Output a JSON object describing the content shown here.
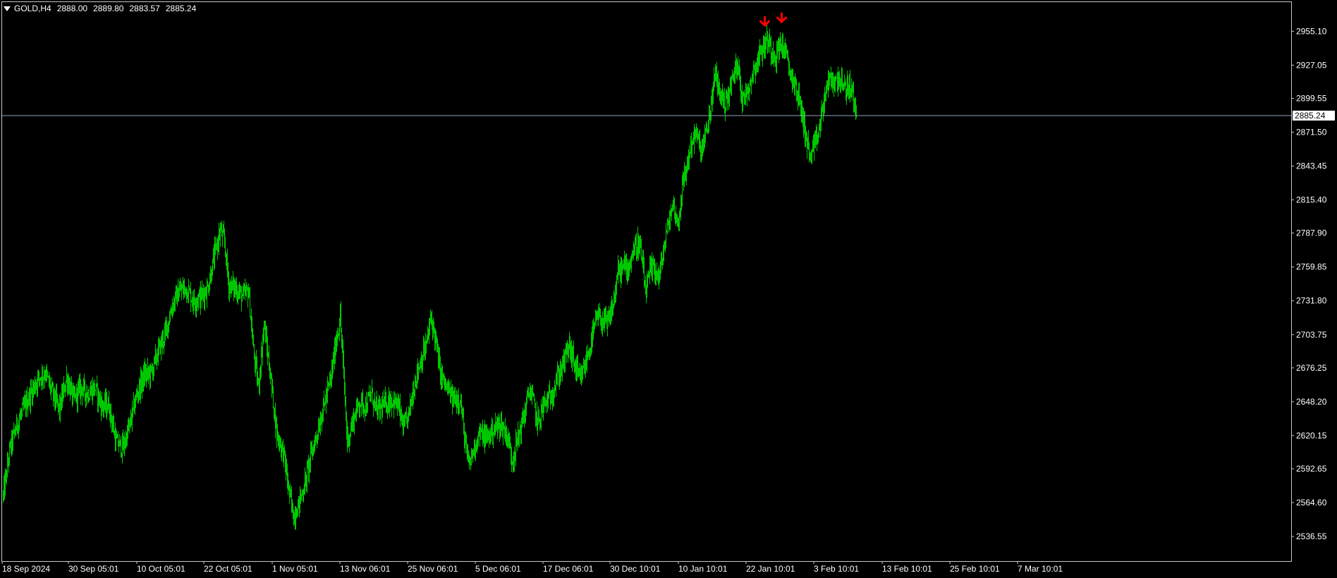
{
  "header": {
    "symbol": "GOLD,H4",
    "open": "2888.00",
    "high": "2889.80",
    "low": "2883.57",
    "close": "2885.24"
  },
  "colors": {
    "background": "#000000",
    "frame": "#c8c8c8",
    "text": "#ffffff",
    "bars": "#00c800",
    "price_line": "#8ea3b8",
    "arrow": "#ff0000"
  },
  "current_price_label": "2885.24",
  "chart_data": {
    "type": "bar",
    "style": "ohlc-bars",
    "symbol": "GOLD",
    "timeframe": "H4",
    "ylim": [
      2522,
      2974
    ],
    "y_ticks": [
      "2955.10",
      "2927.05",
      "2899.55",
      "2871.50",
      "2843.45",
      "2815.40",
      "2787.90",
      "2759.85",
      "2731.80",
      "2703.75",
      "2676.25",
      "2648.20",
      "2620.15",
      "2592.65",
      "2564.60",
      "2536.55"
    ],
    "x_ticks": [
      "18 Sep 2024",
      "30 Sep 05:01",
      "10 Oct 05:01",
      "22 Oct 05:01",
      "1 Nov 05:01",
      "13 Nov 06:01",
      "25 Nov 06:01",
      "5 Dec 06:01",
      "17 Dec 06:01",
      "30 Dec 10:01",
      "10 Jan 10:01",
      "22 Jan 10:01",
      "3 Feb 10:01",
      "13 Feb 10:01",
      "25 Feb 10:01",
      "7 Mar 10:01"
    ],
    "current_price": 2885.24,
    "close_path": [
      [
        0,
        2570
      ],
      [
        10,
        2610
      ],
      [
        20,
        2630
      ],
      [
        35,
        2650
      ],
      [
        50,
        2668
      ],
      [
        60,
        2672
      ],
      [
        70,
        2655
      ],
      [
        80,
        2642
      ],
      [
        90,
        2668
      ],
      [
        100,
        2650
      ],
      [
        110,
        2660
      ],
      [
        120,
        2655
      ],
      [
        130,
        2660
      ],
      [
        140,
        2645
      ],
      [
        150,
        2645
      ],
      [
        160,
        2615
      ],
      [
        170,
        2610
      ],
      [
        180,
        2630
      ],
      [
        190,
        2655
      ],
      [
        200,
        2670
      ],
      [
        210,
        2672
      ],
      [
        220,
        2690
      ],
      [
        230,
        2705
      ],
      [
        240,
        2728
      ],
      [
        250,
        2740
      ],
      [
        260,
        2742
      ],
      [
        270,
        2732
      ],
      [
        280,
        2735
      ],
      [
        290,
        2742
      ],
      [
        300,
        2770
      ],
      [
        308,
        2790
      ],
      [
        314,
        2780
      ],
      [
        320,
        2745
      ],
      [
        330,
        2742
      ],
      [
        340,
        2735
      ],
      [
        348,
        2740
      ],
      [
        355,
        2690
      ],
      [
        362,
        2660
      ],
      [
        370,
        2712
      ],
      [
        380,
        2665
      ],
      [
        388,
        2622
      ],
      [
        398,
        2605
      ],
      [
        405,
        2575
      ],
      [
        412,
        2553
      ],
      [
        420,
        2565
      ],
      [
        428,
        2580
      ],
      [
        435,
        2600
      ],
      [
        445,
        2622
      ],
      [
        455,
        2645
      ],
      [
        465,
        2668
      ],
      [
        472,
        2698
      ],
      [
        478,
        2718
      ],
      [
        482,
        2680
      ],
      [
        488,
        2615
      ],
      [
        495,
        2630
      ],
      [
        505,
        2648
      ],
      [
        515,
        2645
      ],
      [
        522,
        2655
      ],
      [
        530,
        2640
      ],
      [
        540,
        2645
      ],
      [
        550,
        2650
      ],
      [
        560,
        2645
      ],
      [
        568,
        2625
      ],
      [
        575,
        2638
      ],
      [
        585,
        2668
      ],
      [
        592,
        2682
      ],
      [
        600,
        2695
      ],
      [
        607,
        2718
      ],
      [
        613,
        2700
      ],
      [
        620,
        2672
      ],
      [
        628,
        2660
      ],
      [
        638,
        2650
      ],
      [
        648,
        2652
      ],
      [
        655,
        2615
      ],
      [
        660,
        2595
      ],
      [
        668,
        2610
      ],
      [
        675,
        2622
      ],
      [
        685,
        2618
      ],
      [
        695,
        2625
      ],
      [
        705,
        2630
      ],
      [
        715,
        2620
      ],
      [
        722,
        2600
      ],
      [
        730,
        2618
      ],
      [
        740,
        2640
      ],
      [
        746,
        2658
      ],
      [
        752,
        2648
      ],
      [
        758,
        2630
      ],
      [
        766,
        2645
      ],
      [
        776,
        2652
      ],
      [
        786,
        2668
      ],
      [
        796,
        2682
      ],
      [
        802,
        2695
      ],
      [
        810,
        2680
      ],
      [
        818,
        2665
      ],
      [
        826,
        2680
      ],
      [
        835,
        2700
      ],
      [
        842,
        2718
      ],
      [
        850,
        2715
      ],
      [
        857,
        2712
      ],
      [
        865,
        2728
      ],
      [
        872,
        2755
      ],
      [
        880,
        2760
      ],
      [
        887,
        2760
      ],
      [
        893,
        2772
      ],
      [
        900,
        2780
      ],
      [
        905,
        2770
      ],
      [
        911,
        2738
      ],
      [
        917,
        2755
      ],
      [
        923,
        2760
      ],
      [
        930,
        2750
      ],
      [
        937,
        2775
      ],
      [
        943,
        2795
      ],
      [
        950,
        2812
      ],
      [
        957,
        2795
      ],
      [
        963,
        2825
      ],
      [
        970,
        2845
      ],
      [
        977,
        2865
      ],
      [
        983,
        2870
      ],
      [
        990,
        2855
      ],
      [
        997,
        2870
      ],
      [
        1003,
        2890
      ],
      [
        1010,
        2920
      ],
      [
        1016,
        2905
      ],
      [
        1023,
        2895
      ],
      [
        1030,
        2905
      ],
      [
        1036,
        2920
      ],
      [
        1043,
        2930
      ],
      [
        1048,
        2895
      ],
      [
        1054,
        2905
      ],
      [
        1060,
        2915
      ],
      [
        1066,
        2925
      ],
      [
        1072,
        2935
      ],
      [
        1078,
        2942
      ],
      [
        1084,
        2948
      ],
      [
        1090,
        2940
      ],
      [
        1096,
        2935
      ],
      [
        1102,
        2945
      ],
      [
        1108,
        2940
      ],
      [
        1114,
        2925
      ],
      [
        1120,
        2915
      ],
      [
        1126,
        2905
      ],
      [
        1132,
        2890
      ],
      [
        1138,
        2870
      ],
      [
        1144,
        2850
      ],
      [
        1150,
        2858
      ],
      [
        1156,
        2870
      ],
      [
        1162,
        2890
      ],
      [
        1168,
        2910
      ],
      [
        1174,
        2915
      ],
      [
        1180,
        2912
      ],
      [
        1186,
        2918
      ],
      [
        1192,
        2905
      ],
      [
        1198,
        2910
      ],
      [
        1204,
        2905
      ],
      [
        1209,
        2886
      ],
      [
        1210,
        2885
      ]
    ],
    "signals": [
      {
        "type": "sell-arrow",
        "bar_index": 1080,
        "price": 2954
      },
      {
        "type": "sell-arrow",
        "bar_index": 1104,
        "price": 2957
      }
    ]
  }
}
